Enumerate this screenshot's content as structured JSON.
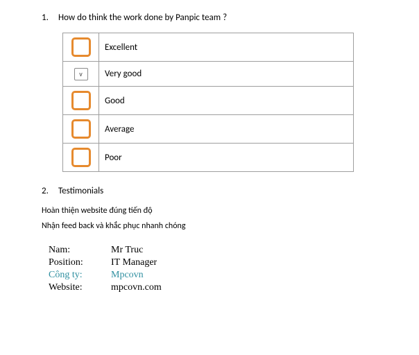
{
  "q1": {
    "number": "1.",
    "text": "How do think the work done by Panpic team ?"
  },
  "ratings": {
    "r0": {
      "label": "Excellent",
      "mark": ""
    },
    "r1": {
      "label": "Very good",
      "mark": "v"
    },
    "r2": {
      "label": "Good",
      "mark": ""
    },
    "r3": {
      "label": "Average",
      "mark": ""
    },
    "r4": {
      "label": "Poor",
      "mark": ""
    }
  },
  "q2": {
    "number": "2.",
    "text": "Testimonials"
  },
  "testimonials": {
    "line1": "Hoàn thiện website đúng tiến độ",
    "line2": "Nhận feed back và khắc phục  nhanh chóng"
  },
  "info": {
    "name_label": "Nam:",
    "name_value": "Mr Truc",
    "pos_label": "Position:",
    "pos_value": "IT Manager",
    "company_label": "Công ty:",
    "company_value": "Mpcovn",
    "web_label": "Website:",
    "web_value": "mpcovn.com"
  }
}
